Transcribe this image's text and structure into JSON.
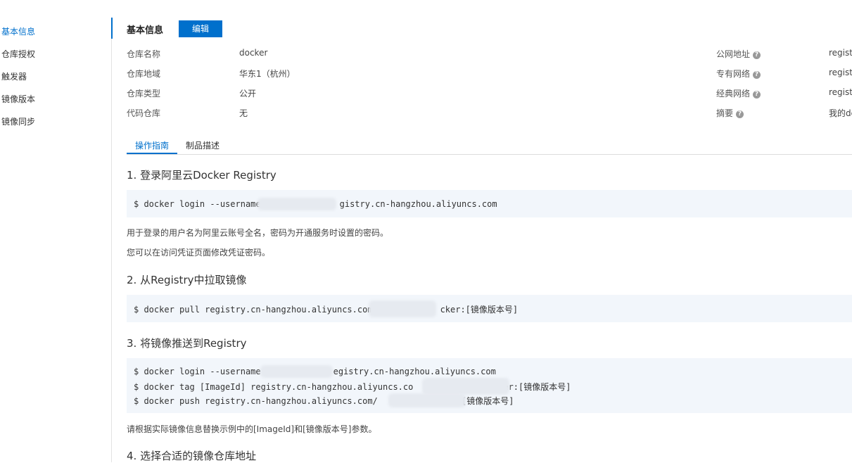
{
  "sidebar": {
    "items": [
      {
        "label": "基本信息"
      },
      {
        "label": "仓库授权"
      },
      {
        "label": "触发器"
      },
      {
        "label": "镜像版本"
      },
      {
        "label": "镜像同步"
      }
    ]
  },
  "header": {
    "title": "基本信息",
    "edit_label": "编辑"
  },
  "info": {
    "repo_name_label": "仓库名称",
    "repo_name": "docker",
    "region_label": "仓库地域",
    "region": "华东1（杭州）",
    "type_label": "仓库类型",
    "type": "公开",
    "code_label": "代码仓库",
    "code": "无",
    "public_label": "公网地址",
    "public_value": "registr",
    "vpc_label": "专有网络",
    "vpc_value": "registr",
    "classic_label": "经典网络",
    "classic_value": "registr",
    "summary_label": "摘要",
    "summary_value": "我的dc"
  },
  "tabs": [
    {
      "label": "操作指南"
    },
    {
      "label": "制品描述"
    }
  ],
  "guide": {
    "step1": {
      "title": "1. 登录阿里云Docker Registry",
      "cmd_prefix": "$ docker login --username",
      "cmd_suffix": "gistry.cn-hangzhou.aliyuncs.com",
      "note1": "用于登录的用户名为阿里云账号全名，密码为开通服务时设置的密码。",
      "note2": "您可以在访问凭证页面修改凭证密码。"
    },
    "step2": {
      "title": "2. 从Registry中拉取镜像",
      "cmd_prefix": "$ docker pull registry.cn-hangzhou.aliyuncs.com",
      "cmd_suffix": "cker:[镜像版本号]"
    },
    "step3": {
      "title": "3. 将镜像推送到Registry",
      "line1_prefix": "$ docker login --username",
      "line1_suffix": "egistry.cn-hangzhou.aliyuncs.com",
      "line2_prefix": "$ docker tag [ImageId] registry.cn-hangzhou.aliyuncs.co",
      "line2_suffix": "er:[镜像版本号]",
      "line3_prefix": "$ docker push registry.cn-hangzhou.aliyuncs.com/",
      "line3_suffix": ":[镜像版本号]",
      "note": "请根据实际镜像信息替换示例中的[ImageId]和[镜像版本号]参数。"
    },
    "step4": {
      "title": "4. 选择合适的镜像仓库地址"
    }
  }
}
